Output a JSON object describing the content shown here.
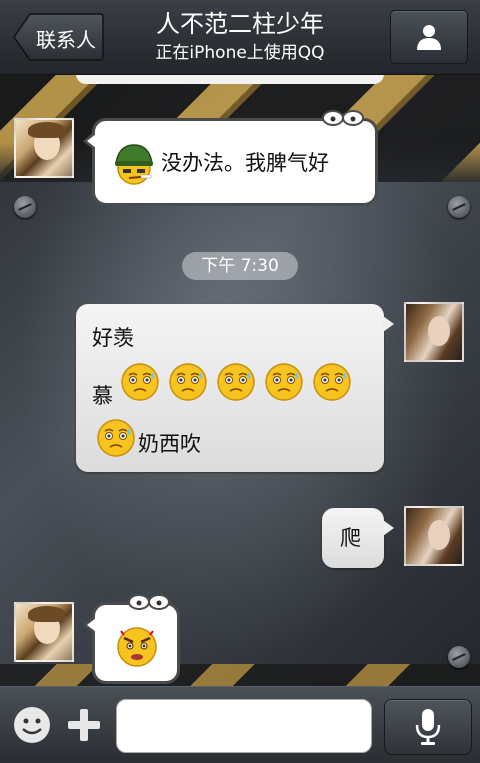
{
  "header": {
    "back_label": "联系人",
    "title": "人不范二柱少年",
    "subtitle": "正在iPhone上使用QQ"
  },
  "messages": [
    {
      "from": "them",
      "text": "没办法。我脾气好",
      "emoji": "soldier-helmet-emoji"
    },
    {
      "time": "下午 7:30"
    },
    {
      "from": "me",
      "line1": "好羡",
      "line2": "慕",
      "line3": "奶西吹",
      "emoji": "worried-sweat-emoji"
    },
    {
      "from": "me",
      "text": "爬"
    },
    {
      "from": "them",
      "emoji": "angry-emoji"
    }
  ],
  "colors": {
    "header_bg": "#2e3338",
    "bubble_white": "#ffffff",
    "bubble_gray": "#e6e6e6",
    "accent_stripe": "#c9a24a"
  }
}
